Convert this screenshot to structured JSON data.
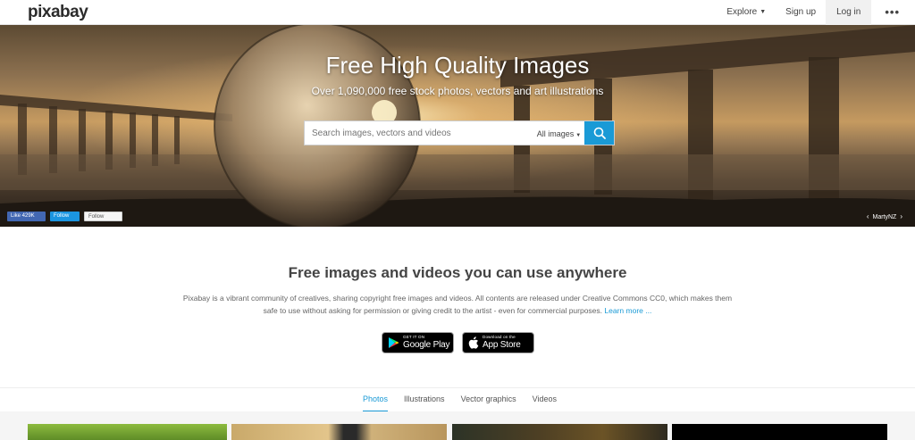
{
  "header": {
    "logo": "pixabay",
    "nav": [
      {
        "label": "Explore",
        "has_caret": true
      },
      {
        "label": "Sign up"
      },
      {
        "label": "Log in"
      },
      {
        "label": "•••"
      }
    ]
  },
  "hero": {
    "title": "Free High Quality Images",
    "subtitle": "Over 1,090,000 free stock photos, vectors and art illustrations",
    "search": {
      "placeholder": "Search images, vectors and videos",
      "value": "",
      "filter_label": "All images"
    },
    "social": {
      "facebook": "Like 429K",
      "twitter": "Follow",
      "gplus": "Follow"
    },
    "credit": "MartyNZ"
  },
  "intro": {
    "title": "Free images and videos you can use anywhere",
    "text": "Pixabay is a vibrant community of creatives, sharing copyright free images and videos. All contents are released under Creative Commons CC0, which makes them safe to use without asking for permission or giving credit to the artist - even for commercial purposes.",
    "learn_more": "Learn more ..."
  },
  "stores": {
    "google": {
      "small": "GET IT ON",
      "big": "Google Play"
    },
    "apple": {
      "small": "Download on the",
      "big": "App Store"
    }
  },
  "tabs": [
    {
      "label": "Photos",
      "active": true
    },
    {
      "label": "Illustrations"
    },
    {
      "label": "Vector graphics"
    },
    {
      "label": "Videos"
    }
  ],
  "colors": {
    "accent": "#1a9ad6",
    "facebook": "#4267b2",
    "twitter": "#1b95e0"
  }
}
